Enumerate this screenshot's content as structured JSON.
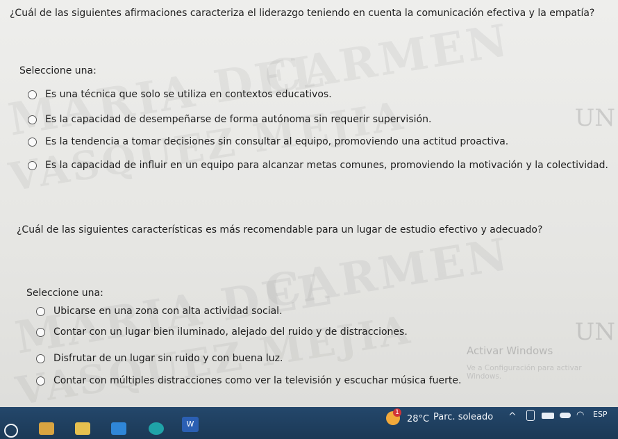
{
  "question1": {
    "text": "¿Cuál de las siguientes afirmaciones caracteriza el liderazgo teniendo en cuenta la comunicación efectiva y la empatía?",
    "prompt": "Seleccione una:",
    "options": [
      "Es una técnica que solo se utiliza en contextos educativos.",
      "Es la capacidad de desempeñarse de forma autónoma sin requerir supervisión.",
      "Es la tendencia a tomar decisiones sin consultar al equipo, promoviendo una actitud proactiva.",
      "Es la capacidad de influir en un equipo para alcanzar metas comunes, promoviendo la motivación y la colectividad."
    ]
  },
  "question2": {
    "text": "¿Cuál de las siguientes características es más recomendable para un lugar de estudio efectivo y adecuado?",
    "prompt": "Seleccione una:",
    "options": [
      "Ubicarse en una zona con alta actividad social.",
      "Contar con un lugar bien iluminado, alejado del ruido y de distracciones.",
      "Disfrutar de un lugar sin ruido y con buena luz.",
      "Contar con múltiples distracciones como ver la televisión y escuchar música fuerte."
    ]
  },
  "watermarks": {
    "line1": "CARMEN",
    "line2": "MARIA DEL",
    "line3": "VASQUEZ MEJIA",
    "logo": "UN"
  },
  "activation": {
    "title": "Activar Windows",
    "subtitle": "Ve a Configuración para activar Windows."
  },
  "taskbar": {
    "weather_badge": "1",
    "temperature": "28°C",
    "weather": "Parc. soleado",
    "language": "ESP",
    "word_letter": "W"
  },
  "colors": {
    "taskbar": "#1e3f5f",
    "radio_border": "#555555"
  }
}
